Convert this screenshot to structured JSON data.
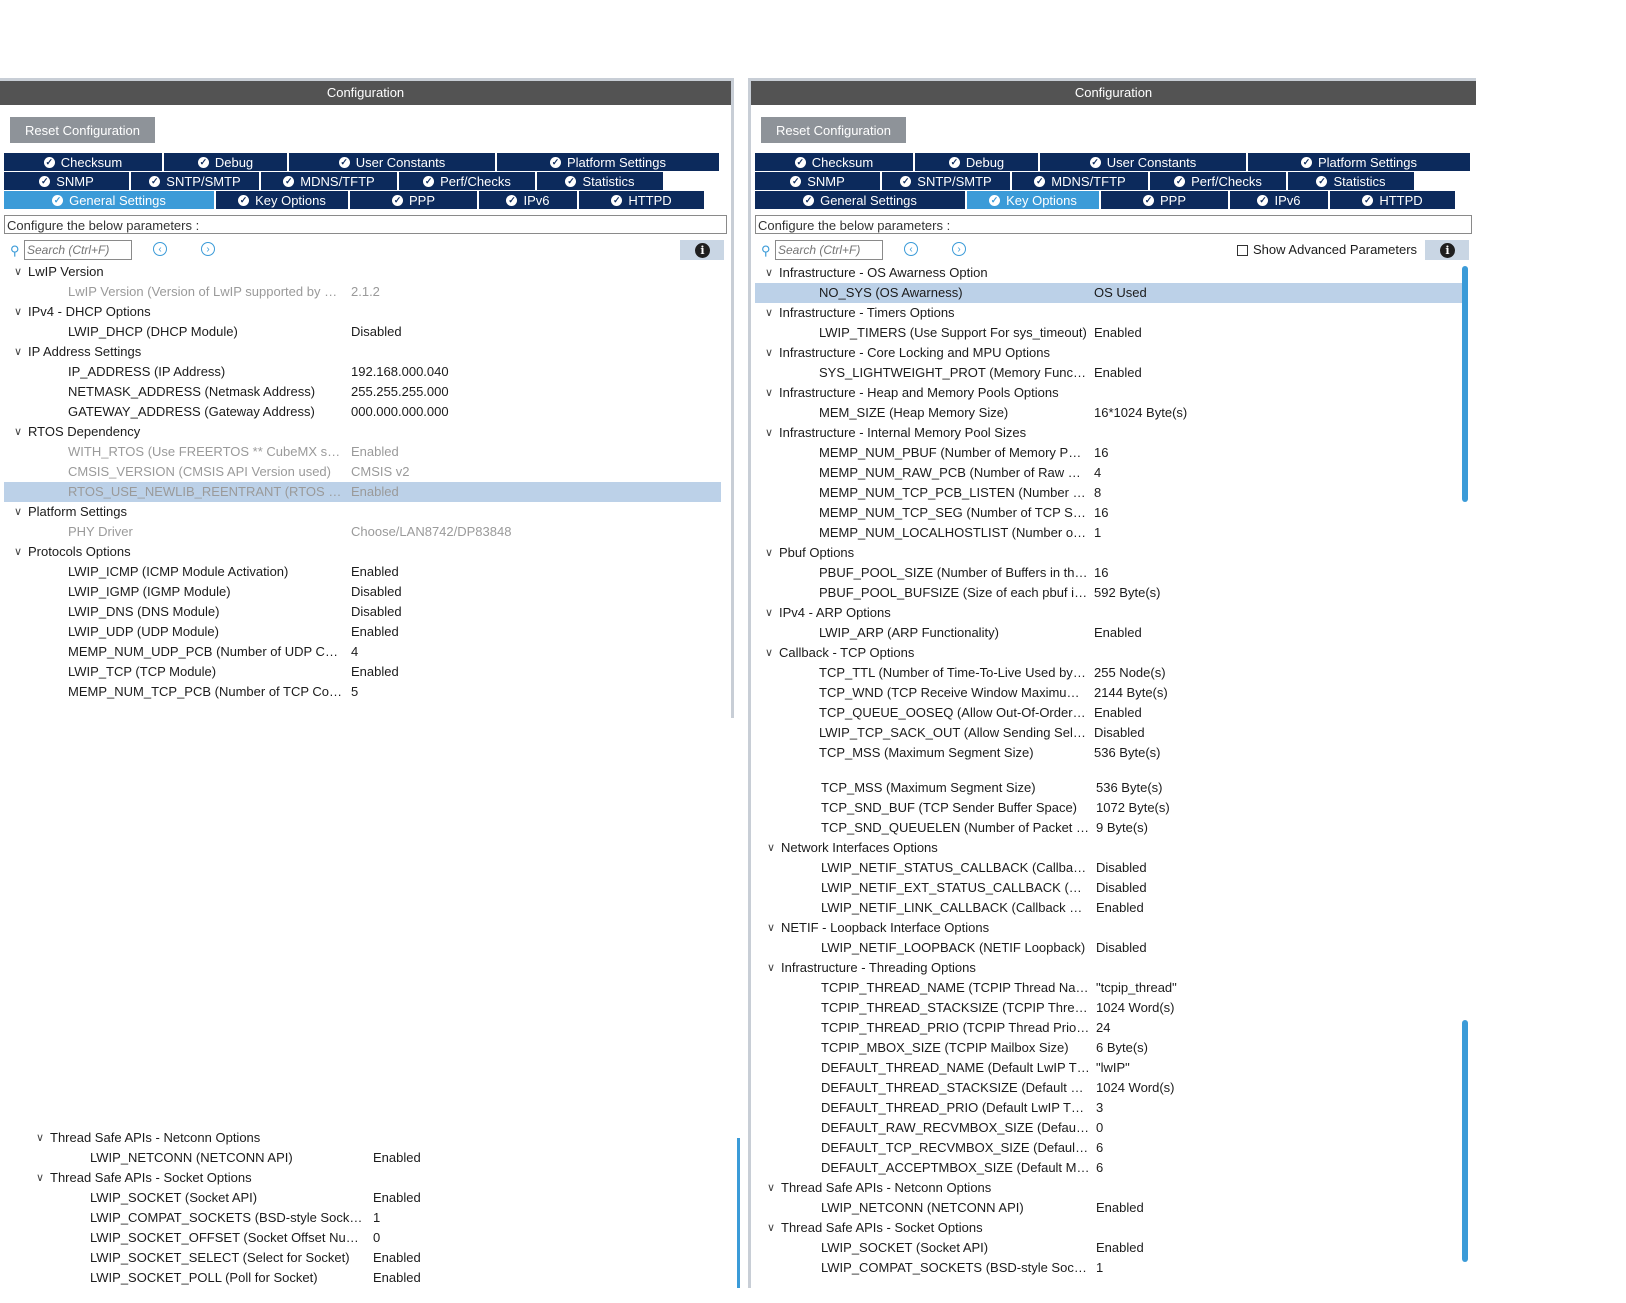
{
  "left_panel": {
    "title": "Configuration",
    "reset_label": "Reset Configuration",
    "tabs_row1": [
      "Checksum",
      "Debug",
      "User Constants",
      "Platform Settings"
    ],
    "tabs_row2": [
      "SNMP",
      "SNTP/SMTP",
      "MDNS/TFTP",
      "Perf/Checks",
      "Statistics"
    ],
    "tabs_row3": [
      "General Settings",
      "Key Options",
      "PPP",
      "IPv6",
      "HTTPD"
    ],
    "active_tab": "General Settings",
    "configure_text": "Configure the below parameters :",
    "search_placeholder": "Search (Ctrl+F)",
    "groups": [
      {
        "name": "LwIP Version",
        "params": [
          {
            "name": "LwIP Version (Version of LwIP supported by Cu...",
            "value": "2.1.2",
            "dim": true
          }
        ]
      },
      {
        "name": "IPv4 - DHCP Options",
        "params": [
          {
            "name": "LWIP_DHCP (DHCP Module)",
            "value": "Disabled"
          }
        ]
      },
      {
        "name": "IP Address Settings",
        "params": [
          {
            "name": "IP_ADDRESS (IP Address)",
            "value": "192.168.000.040"
          },
          {
            "name": "NETMASK_ADDRESS (Netmask Address)",
            "value": "255.255.255.000"
          },
          {
            "name": "GATEWAY_ADDRESS (Gateway Address)",
            "value": "000.000.000.000"
          }
        ]
      },
      {
        "name": "RTOS Dependency",
        "params": [
          {
            "name": "WITH_RTOS (Use FREERTOS ** CubeMX spec...",
            "value": "Enabled",
            "dim": true
          },
          {
            "name": "CMSIS_VERSION (CMSIS API Version used)",
            "value": "CMSIS v2",
            "dim": true
          },
          {
            "name": "RTOS_USE_NEWLIB_REENTRANT (RTOS use...",
            "value": "Enabled",
            "dim": true,
            "selected": true
          }
        ]
      },
      {
        "name": "Platform Settings",
        "params": [
          {
            "name": "PHY Driver",
            "value": "Choose/LAN8742/DP83848",
            "dim": true
          }
        ]
      },
      {
        "name": "Protocols Options",
        "params": [
          {
            "name": "LWIP_ICMP (ICMP Module Activation)",
            "value": "Enabled"
          },
          {
            "name": "LWIP_IGMP (IGMP Module)",
            "value": "Disabled"
          },
          {
            "name": "LWIP_DNS (DNS Module)",
            "value": "Disabled"
          },
          {
            "name": "LWIP_UDP (UDP Module)",
            "value": "Enabled"
          },
          {
            "name": "MEMP_NUM_UDP_PCB (Number of UDP Conn...",
            "value": "4"
          },
          {
            "name": "LWIP_TCP (TCP Module)",
            "value": "Enabled"
          },
          {
            "name": "MEMP_NUM_TCP_PCB (Number of TCP Conne...",
            "value": "5"
          }
        ]
      }
    ]
  },
  "right_panel": {
    "title": "Configuration",
    "reset_label": "Reset Configuration",
    "tabs_row1": [
      "Checksum",
      "Debug",
      "User Constants",
      "Platform Settings"
    ],
    "tabs_row2": [
      "SNMP",
      "SNTP/SMTP",
      "MDNS/TFTP",
      "Perf/Checks",
      "Statistics"
    ],
    "tabs_row3": [
      "General Settings",
      "Key Options",
      "PPP",
      "IPv6",
      "HTTPD"
    ],
    "active_tab": "Key Options",
    "configure_text": "Configure the below parameters :",
    "search_placeholder": "Search (Ctrl+F)",
    "advanced_label": "Show Advanced Parameters",
    "groups": [
      {
        "name": "Infrastructure - OS Awarness Option",
        "params": [
          {
            "name": "NO_SYS (OS Awarness)",
            "value": "OS Used",
            "selected": true
          }
        ]
      },
      {
        "name": "Infrastructure - Timers Options",
        "params": [
          {
            "name": "LWIP_TIMERS (Use Support For sys_timeout)",
            "value": "Enabled"
          }
        ]
      },
      {
        "name": "Infrastructure - Core Locking and MPU Options",
        "params": [
          {
            "name": "SYS_LIGHTWEIGHT_PROT (Memory Function...",
            "value": "Enabled"
          }
        ]
      },
      {
        "name": "Infrastructure - Heap and Memory Pools Options",
        "params": [
          {
            "name": "MEM_SIZE (Heap Memory Size)",
            "value": "16*1024 Byte(s)"
          }
        ]
      },
      {
        "name": "Infrastructure - Internal Memory Pool Sizes",
        "params": [
          {
            "name": "MEMP_NUM_PBUF (Number of Memory Pool ...",
            "value": "16"
          },
          {
            "name": "MEMP_NUM_RAW_PCB (Number of Raw Prot...",
            "value": "4"
          },
          {
            "name": "MEMP_NUM_TCP_PCB_LISTEN (Number of Li...",
            "value": "8"
          },
          {
            "name": "MEMP_NUM_TCP_SEG (Number of TCP Seg...",
            "value": "16"
          },
          {
            "name": "MEMP_NUM_LOCALHOSTLIST (Number of Ho...",
            "value": "1"
          }
        ]
      },
      {
        "name": "Pbuf Options",
        "params": [
          {
            "name": "PBUF_POOL_SIZE (Number of Buffers in the P...",
            "value": "16"
          },
          {
            "name": "PBUF_POOL_BUFSIZE (Size of each pbuf in t...",
            "value": "592 Byte(s)"
          }
        ]
      },
      {
        "name": "IPv4 - ARP Options",
        "params": [
          {
            "name": "LWIP_ARP (ARP Functionality)",
            "value": "Enabled"
          }
        ]
      },
      {
        "name": "Callback - TCP Options",
        "params": [
          {
            "name": "TCP_TTL (Number of Time-To-Live Used by TC...",
            "value": "255 Node(s)"
          },
          {
            "name": "TCP_WND (TCP Receive Window Maximum Si...",
            "value": "2144 Byte(s)"
          },
          {
            "name": "TCP_QUEUE_OOSEQ (Allow Out-Of-Order Inc...",
            "value": "Enabled"
          },
          {
            "name": "LWIP_TCP_SACK_OUT (Allow Sending Selecti...",
            "value": "Disabled"
          },
          {
            "name": "TCP_MSS (Maximum Segment Size)",
            "value": "536 Byte(s)"
          }
        ]
      }
    ]
  },
  "right_continued": {
    "rows": [
      {
        "name": "TCP_MSS (Maximum Segment Size)",
        "value": "536 Byte(s)"
      },
      {
        "name": "TCP_SND_BUF (TCP Sender Buffer Space)",
        "value": "1072 Byte(s)"
      },
      {
        "name": "TCP_SND_QUEUELEN (Number of Packet Buff...",
        "value": "9 Byte(s)"
      }
    ],
    "groups": [
      {
        "name": "Network Interfaces Options",
        "params": [
          {
            "name": "LWIP_NETIF_STATUS_CALLBACK (Callback ...",
            "value": "Disabled"
          },
          {
            "name": "LWIP_NETIF_EXT_STATUS_CALLBACK (Exte...",
            "value": "Disabled"
          },
          {
            "name": "LWIP_NETIF_LINK_CALLBACK (Callback Fun...",
            "value": "Enabled"
          }
        ]
      },
      {
        "name": "NETIF - Loopback Interface Options",
        "params": [
          {
            "name": "LWIP_NETIF_LOOPBACK (NETIF Loopback)",
            "value": "Disabled"
          }
        ]
      },
      {
        "name": "Infrastructure - Threading Options",
        "params": [
          {
            "name": "TCPIP_THREAD_NAME (TCPIP Thread Name)",
            "value": "\"tcpip_thread\""
          },
          {
            "name": "TCPIP_THREAD_STACKSIZE (TCPIP Thread S...",
            "value": "1024 Word(s)"
          },
          {
            "name": "TCPIP_THREAD_PRIO (TCPIP Thread Priority ...",
            "value": "24"
          },
          {
            "name": "TCPIP_MBOX_SIZE (TCPIP Mailbox Size)",
            "value": "6 Byte(s)"
          },
          {
            "name": "DEFAULT_THREAD_NAME (Default LwIP Thre...",
            "value": "\"lwIP\""
          },
          {
            "name": "DEFAULT_THREAD_STACKSIZE (Default LwIP...",
            "value": "1024 Word(s)"
          },
          {
            "name": "DEFAULT_THREAD_PRIO (Default LwIP Threa...",
            "value": "3"
          },
          {
            "name": "DEFAULT_RAW_RECVMBOX_SIZE (Default M...",
            "value": "0"
          },
          {
            "name": "DEFAULT_TCP_RECVMBOX_SIZE (Default Ma...",
            "value": "6"
          },
          {
            "name": "DEFAULT_ACCEPTMBOX_SIZE (Default Mailb...",
            "value": "6"
          }
        ]
      },
      {
        "name": "Thread Safe APIs - Netconn Options",
        "params": [
          {
            "name": "LWIP_NETCONN (NETCONN API)",
            "value": "Enabled"
          }
        ]
      },
      {
        "name": "Thread Safe APIs - Socket Options",
        "params": [
          {
            "name": "LWIP_SOCKET (Socket API)",
            "value": "Enabled"
          },
          {
            "name": "LWIP_COMPAT_SOCKETS (BSD-style Socket...",
            "value": "1"
          }
        ]
      }
    ]
  },
  "left_continued": {
    "groups": [
      {
        "name": "Thread Safe APIs - Netconn Options",
        "params": [
          {
            "name": "LWIP_NETCONN (NETCONN API)",
            "value": "Enabled"
          }
        ]
      },
      {
        "name": "Thread Safe APIs - Socket Options",
        "params": [
          {
            "name": "LWIP_SOCKET (Socket API)",
            "value": "Enabled"
          },
          {
            "name": "LWIP_COMPAT_SOCKETS (BSD-style Socket...",
            "value": "1"
          },
          {
            "name": "LWIP_SOCKET_OFFSET (Socket Offset Numb...",
            "value": "0"
          },
          {
            "name": "LWIP_SOCKET_SELECT (Select for Socket)",
            "value": "Enabled"
          },
          {
            "name": "LWIP_SOCKET_POLL (Poll for Socket)",
            "value": "Enabled"
          }
        ]
      }
    ]
  },
  "colors": {
    "tab_bg": "#0c2a5c",
    "tab_active": "#3b9bd8",
    "title_bg": "#535353",
    "selected_row": "#bcd1e8",
    "reset_bg": "#8e9399"
  }
}
